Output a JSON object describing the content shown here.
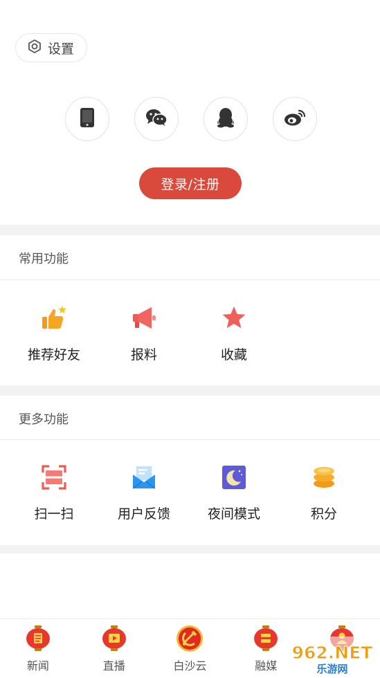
{
  "header": {
    "settings_label": "设置"
  },
  "login": {
    "methods": [
      {
        "icon": "phone-icon"
      },
      {
        "icon": "wechat-icon"
      },
      {
        "icon": "qq-icon"
      },
      {
        "icon": "weibo-icon"
      }
    ],
    "button_label": "登录/注册"
  },
  "common_functions": {
    "title": "常用功能",
    "items": [
      {
        "label": "推荐好友",
        "icon": "thumbs-up-icon"
      },
      {
        "label": "报料",
        "icon": "megaphone-icon"
      },
      {
        "label": "收藏",
        "icon": "star-icon"
      }
    ]
  },
  "more_functions": {
    "title": "更多功能",
    "items": [
      {
        "label": "扫一扫",
        "icon": "scan-icon"
      },
      {
        "label": "用户反馈",
        "icon": "feedback-mail-icon"
      },
      {
        "label": "夜间模式",
        "icon": "night-mode-icon"
      },
      {
        "label": "积分",
        "icon": "coins-icon"
      }
    ]
  },
  "tabbar": {
    "items": [
      {
        "label": "新闻"
      },
      {
        "label": "直播"
      },
      {
        "label": "白沙云"
      },
      {
        "label": "融媒"
      },
      {
        "label": ""
      }
    ]
  },
  "watermark": {
    "main": "962.NET",
    "sub": "乐游网"
  },
  "colors": {
    "accent": "#d94a3c",
    "section_gap": "#f2f2f2"
  }
}
